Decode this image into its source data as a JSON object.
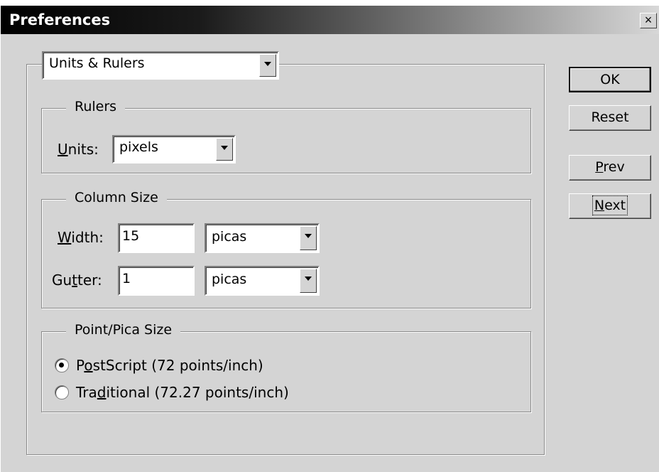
{
  "window": {
    "title": "Preferences",
    "close_label": "×"
  },
  "section_select": {
    "value": "Units & Rulers"
  },
  "rulers": {
    "legend": "Rulers",
    "units_label_pre": "",
    "units_label_u": "U",
    "units_label_post": "nits:",
    "units_value": "pixels"
  },
  "column_size": {
    "legend": "Column Size",
    "width_label_u": "W",
    "width_label_post": "idth:",
    "width_value": "15",
    "width_unit": "picas",
    "gutter_label_pre": "Gu",
    "gutter_label_u": "t",
    "gutter_label_post": "ter:",
    "gutter_value": "1",
    "gutter_unit": "picas"
  },
  "point_pica": {
    "legend": "Point/Pica Size",
    "postscript_pre": "P",
    "postscript_u": "o",
    "postscript_post": "stScript (72 points/inch)",
    "traditional_pre": "Tra",
    "traditional_u": "d",
    "traditional_post": "itional (72.27 points/inch)",
    "selected": "postscript"
  },
  "buttons": {
    "ok": "OK",
    "reset": "Reset",
    "prev_u": "P",
    "prev_post": "rev",
    "next_u": "N",
    "next_post": "ext"
  }
}
